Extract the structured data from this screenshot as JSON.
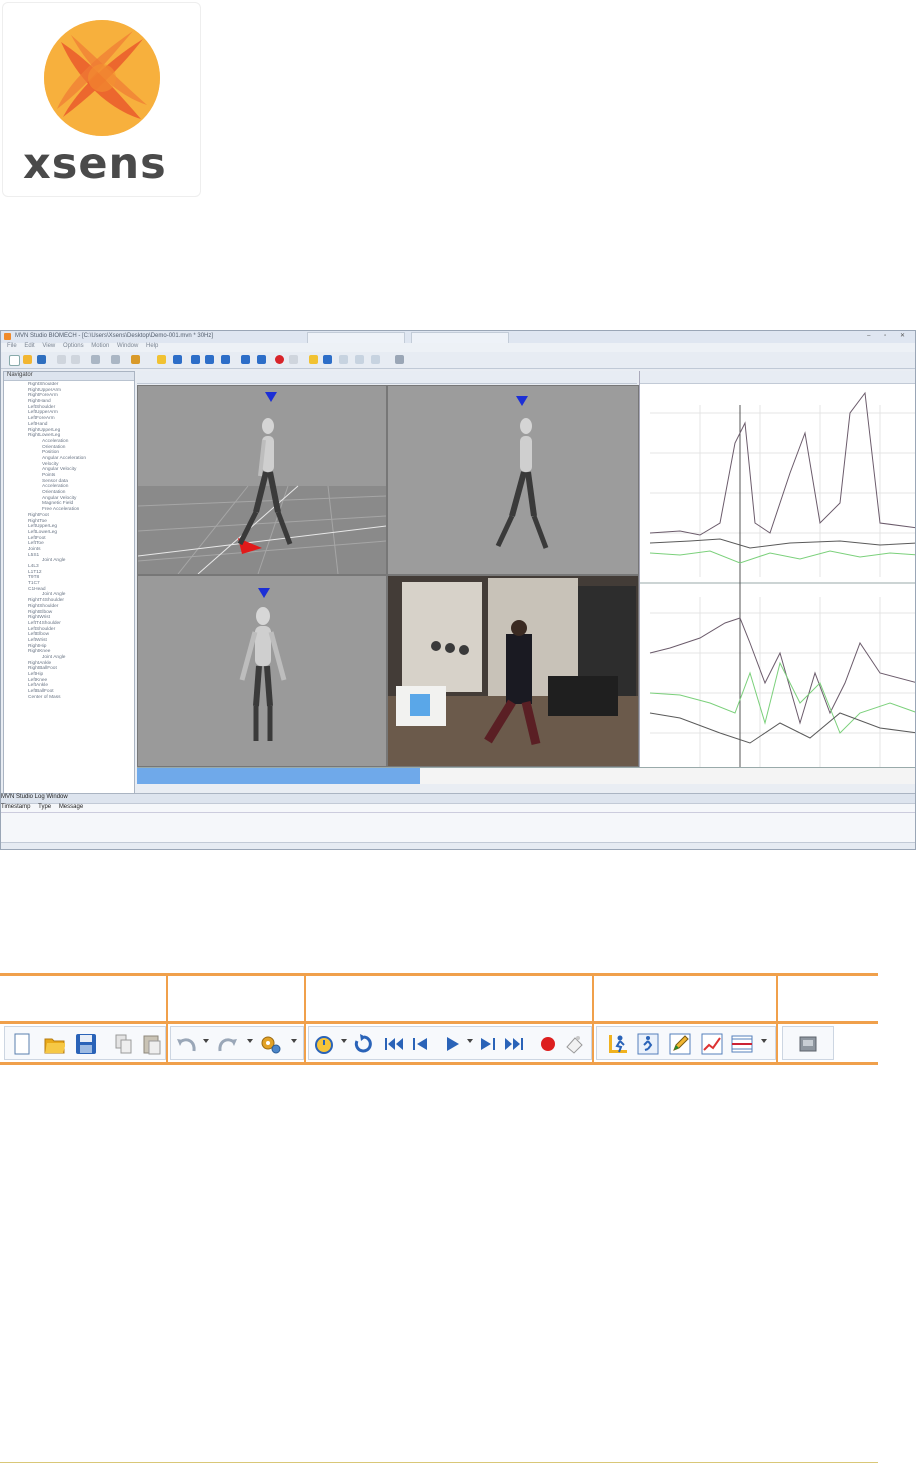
{
  "logo": {
    "wordmark": "xsens",
    "colors": {
      "orange": "#f39130",
      "light_orange": "#f8b53f",
      "red": "#ea5a2c",
      "gray": "#4a4a4a"
    }
  },
  "screenshot": {
    "title_text": "MVN Studio BIOMECH - [C:\\Users\\Xsens\\Desktop\\Demo-001.mvn * 30Hz]",
    "menu_items": [
      "File",
      "Edit",
      "View",
      "Options",
      "Motion",
      "Window",
      "Help"
    ],
    "panel_title": "Navigator",
    "nav_items": [
      "RightShoulder",
      "RightUpperArm",
      "RightForeArm",
      "RightHand",
      "LeftShoulder",
      "LeftUpperArm",
      "LeftForeArm",
      "LeftHand",
      "RightUpperLeg",
      "RightLowerLeg",
      "Acceleration",
      "Orientation",
      "Position",
      "Angular Acceleration",
      "Velocity",
      "Angular Velocity",
      "Points",
      "Sensor data",
      "Acceleration",
      "Orientation",
      "Angular Velocity",
      "Magnetic Field",
      "Free Acceleration",
      "RightFoot",
      "RightToe",
      "LeftUpperLeg",
      "LeftLowerLeg",
      "LeftFoot",
      "LeftToe",
      "Joints",
      "L5S1",
      "Joint Angle",
      "L4L3",
      "L1T12",
      "T9T8",
      "T1C7",
      "C1Head",
      "Joint Angle",
      "RightT4Shoulder",
      "RightShoulder",
      "RightElbow",
      "RightWrist",
      "LeftT4Shoulder",
      "LeftShoulder",
      "LeftElbow",
      "LeftWrist",
      "RightHip",
      "RightKnee",
      "Joint Angle",
      "RightAnkle",
      "RightBallFoot",
      "LeftHip",
      "LeftKnee",
      "LeftAnkle",
      "LeftBallFoot",
      "Center of Mass"
    ],
    "log_title": "MVN Studio Log Window",
    "log_columns": [
      "Timestamp",
      "Type",
      "Message"
    ]
  },
  "toolbar_table": {
    "groups": [
      {
        "name": "file",
        "icons": [
          "new-file-icon",
          "open-folder-icon",
          "save-icon",
          "copy-icon",
          "paste-icon"
        ]
      },
      {
        "name": "edit",
        "icons": [
          "undo-icon",
          "redo-icon",
          "settings-gears-icon"
        ]
      },
      {
        "name": "playback",
        "icons": [
          "stopwatch-icon",
          "reload-icon",
          "skip-to-start-icon",
          "previous-frame-icon",
          "play-icon",
          "next-frame-icon",
          "skip-to-end-icon",
          "record-icon",
          "marker-icon"
        ]
      },
      {
        "name": "views",
        "icons": [
          "calibrate-figure-icon",
          "character-view-icon",
          "edit-pencil-icon",
          "graph-icon",
          "layout-split-icon"
        ]
      },
      {
        "name": "other",
        "icons": [
          "log-window-icon"
        ]
      }
    ]
  }
}
